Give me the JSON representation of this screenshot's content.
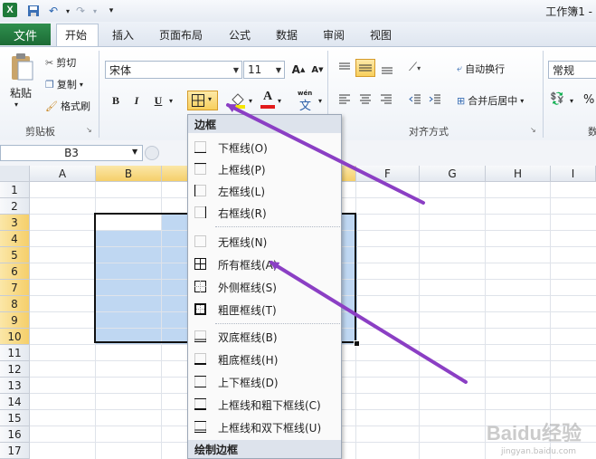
{
  "window": {
    "title": "工作簿1 -"
  },
  "tabs": {
    "file": "文件",
    "home": "开始",
    "insert": "插入",
    "page_layout": "页面布局",
    "formulas": "公式",
    "data": "数据",
    "review": "审阅",
    "view": "视图"
  },
  "ribbon": {
    "clipboard": {
      "paste": "粘贴",
      "cut": "剪切",
      "copy": "复制",
      "format_painter": "格式刷",
      "group": "剪贴板"
    },
    "font": {
      "name": "宋体",
      "size": "11",
      "bold": "B",
      "italic": "I",
      "underline": "U",
      "font_color_letter": "A",
      "wen": "wén",
      "wen2": "文"
    },
    "alignment": {
      "wrap_text": "自动换行",
      "merge_center": "合并后居中",
      "group": "对齐方式"
    },
    "number": {
      "format": "常规",
      "percent": "%",
      "group_partial": "数"
    }
  },
  "formula_bar": {
    "name_box": "B3"
  },
  "grid": {
    "columns": [
      "A",
      "B",
      "C",
      "D",
      "E",
      "F",
      "G",
      "H",
      "I"
    ],
    "rows": [
      "1",
      "2",
      "3",
      "4",
      "5",
      "6",
      "7",
      "8",
      "9",
      "10",
      "11",
      "12",
      "13",
      "14",
      "15",
      "16",
      "17"
    ]
  },
  "border_menu": {
    "header": "边框",
    "items": [
      {
        "label": "下框线(O)",
        "icon": "bottom-border-icon"
      },
      {
        "label": "上框线(P)",
        "icon": "top-border-icon"
      },
      {
        "label": "左框线(L)",
        "icon": "left-border-icon"
      },
      {
        "label": "右框线(R)",
        "icon": "right-border-icon"
      },
      {
        "label": "无框线(N)",
        "icon": "no-border-icon"
      },
      {
        "label": "所有框线(A)",
        "icon": "all-borders-icon"
      },
      {
        "label": "外侧框线(S)",
        "icon": "outside-borders-icon"
      },
      {
        "label": "粗匣框线(T)",
        "icon": "thick-box-border-icon"
      },
      {
        "label": "双底框线(B)",
        "icon": "double-bottom-border-icon"
      },
      {
        "label": "粗底框线(H)",
        "icon": "thick-bottom-border-icon"
      },
      {
        "label": "上下框线(D)",
        "icon": "top-bottom-border-icon"
      },
      {
        "label": "上框线和粗下框线(C)",
        "icon": "top-thick-bottom-border-icon"
      },
      {
        "label": "上框线和双下框线(U)",
        "icon": "top-double-bottom-border-icon"
      }
    ],
    "footer_header": "绘制边框"
  },
  "watermark": {
    "text": "Baidu经验",
    "sub": "jingyan.baidu.com"
  },
  "colors": {
    "file_tab": "#1c6b35",
    "selection": "#bfd7f2",
    "header_selected": "#f5cf6a",
    "arrow": "#8b3fc4"
  }
}
